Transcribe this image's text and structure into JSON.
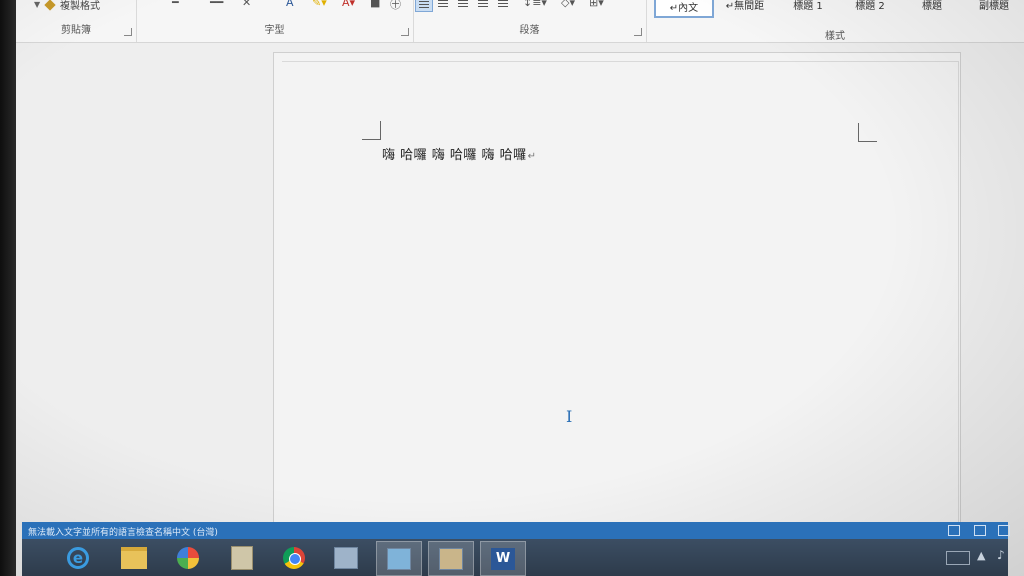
{
  "ribbon": {
    "clipboard": {
      "format_painter_label": "複製格式",
      "group_label": "剪貼簿"
    },
    "font": {
      "group_label": "字型"
    },
    "paragraph": {
      "group_label": "段落"
    },
    "styles": {
      "group_label": "樣式",
      "items": [
        {
          "label": "↵內文",
          "active": true
        },
        {
          "label": "↵無間距",
          "active": false
        },
        {
          "label": "標題 1",
          "active": false
        },
        {
          "label": "標題 2",
          "active": false
        },
        {
          "label": "標題",
          "active": false
        },
        {
          "label": "副標題",
          "active": false
        }
      ]
    }
  },
  "document": {
    "text": "嗨 哈囉 嗨 哈囉 嗨 哈囉",
    "para_mark": "↵"
  },
  "statusbar": {
    "text": "無法載入文字並所有的語言檢查名稱中文 (台灣)"
  },
  "taskbar": {
    "items": [
      {
        "name": "internet-explorer",
        "icon": "ie-icon"
      },
      {
        "name": "file-explorer",
        "icon": "folder-icon"
      },
      {
        "name": "color-app",
        "icon": "color-icon"
      },
      {
        "name": "document-app",
        "icon": "doc-icon"
      },
      {
        "name": "chrome",
        "icon": "chrome-icon"
      },
      {
        "name": "app-6",
        "icon": "app-icon"
      },
      {
        "name": "app-7",
        "icon": "app-icon"
      },
      {
        "name": "app-8",
        "icon": "app-icon"
      },
      {
        "name": "word",
        "icon": "word-icon",
        "label": "W"
      }
    ]
  },
  "colors": {
    "accent": "#2b71b9",
    "taskbar": "#34465a",
    "word_blue": "#2b5797"
  }
}
